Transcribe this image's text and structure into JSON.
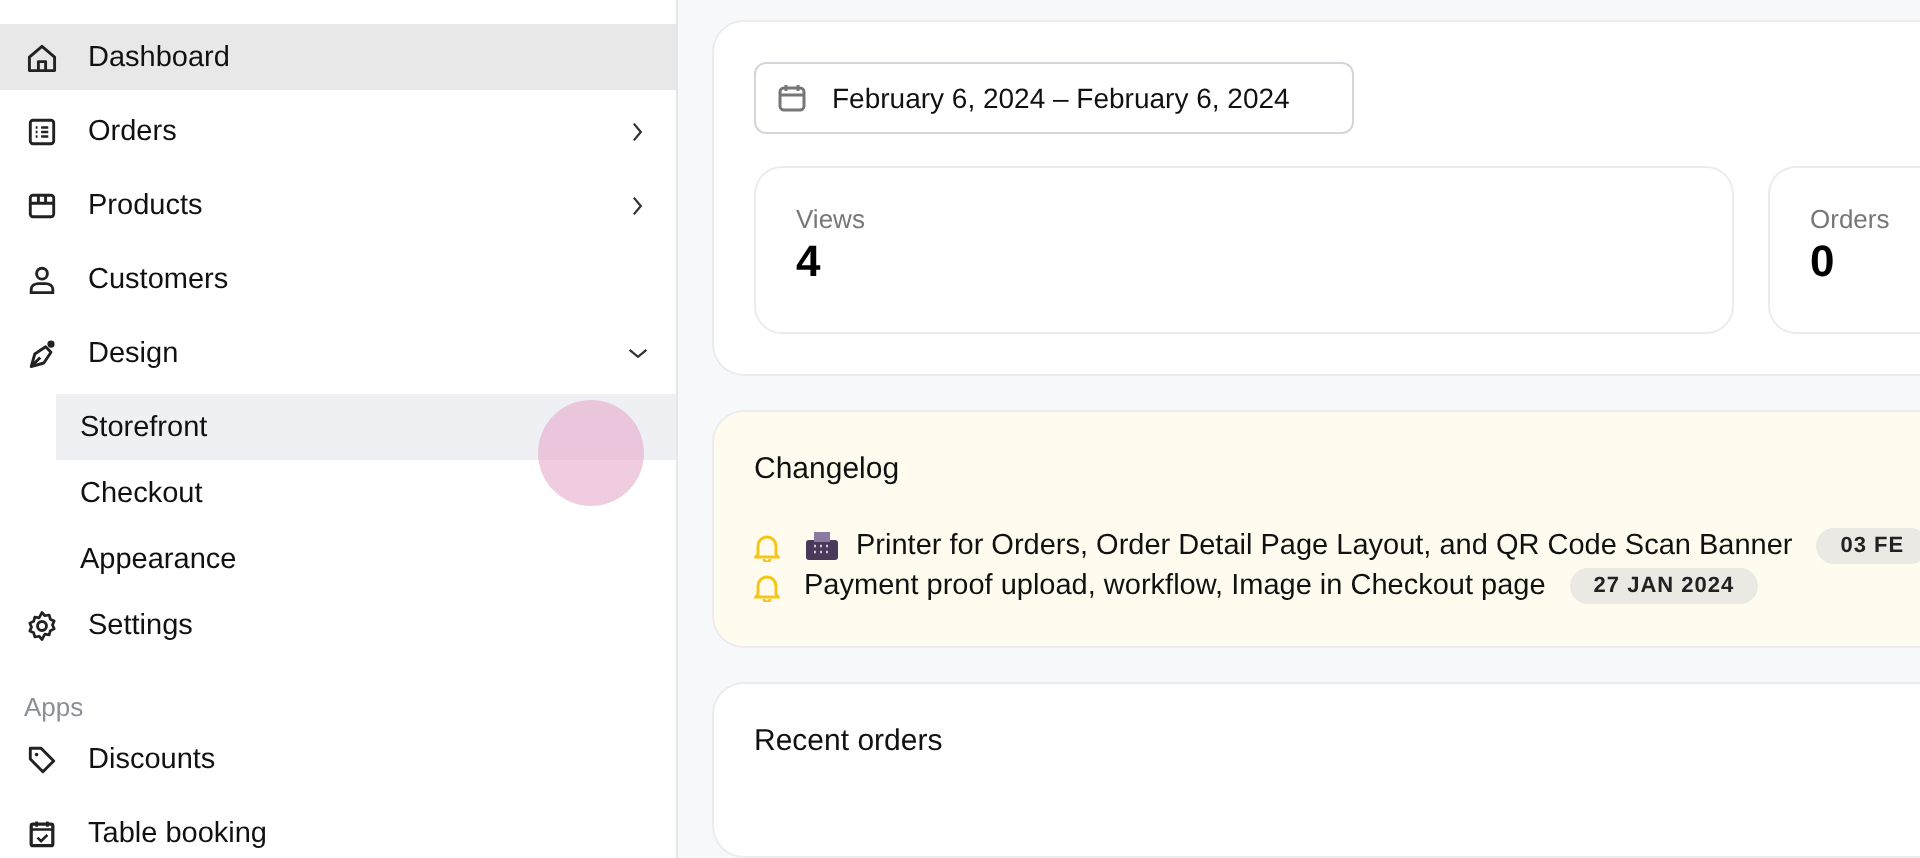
{
  "sidebar": {
    "items": [
      {
        "label": "Dashboard",
        "kind": "link",
        "selected": true
      },
      {
        "label": "Orders",
        "kind": "group",
        "expanded": false,
        "selected": false
      },
      {
        "label": "Products",
        "kind": "group",
        "expanded": false,
        "selected": false
      },
      {
        "label": "Customers",
        "kind": "link",
        "selected": false
      },
      {
        "label": "Design",
        "kind": "group",
        "expanded": true,
        "selected": false,
        "children": [
          {
            "label": "Storefront",
            "selected": true
          },
          {
            "label": "Checkout",
            "selected": false
          },
          {
            "label": "Appearance",
            "selected": false
          }
        ]
      },
      {
        "label": "Settings",
        "kind": "link",
        "selected": false
      }
    ],
    "section_title": "Apps",
    "apps": [
      {
        "label": "Discounts",
        "selected": false
      },
      {
        "label": "Table booking",
        "selected": false
      }
    ]
  },
  "date_range": {
    "value": "February 6, 2024 – February 6, 2024"
  },
  "stats": [
    {
      "label": "Views",
      "value": "4"
    },
    {
      "label": "Orders",
      "value": "0"
    }
  ],
  "changelog": {
    "title": "Changelog",
    "entries": [
      {
        "kind": "with-icon",
        "text": "Printer for Orders, Order Detail Page Layout, and QR Code Scan Banner",
        "date": "03 FE"
      },
      {
        "kind": "plain",
        "text": "Payment proof upload, workflow, Image in Checkout page",
        "date": "27 JAN 2024"
      }
    ]
  },
  "recent_orders": {
    "title": "Recent orders"
  }
}
